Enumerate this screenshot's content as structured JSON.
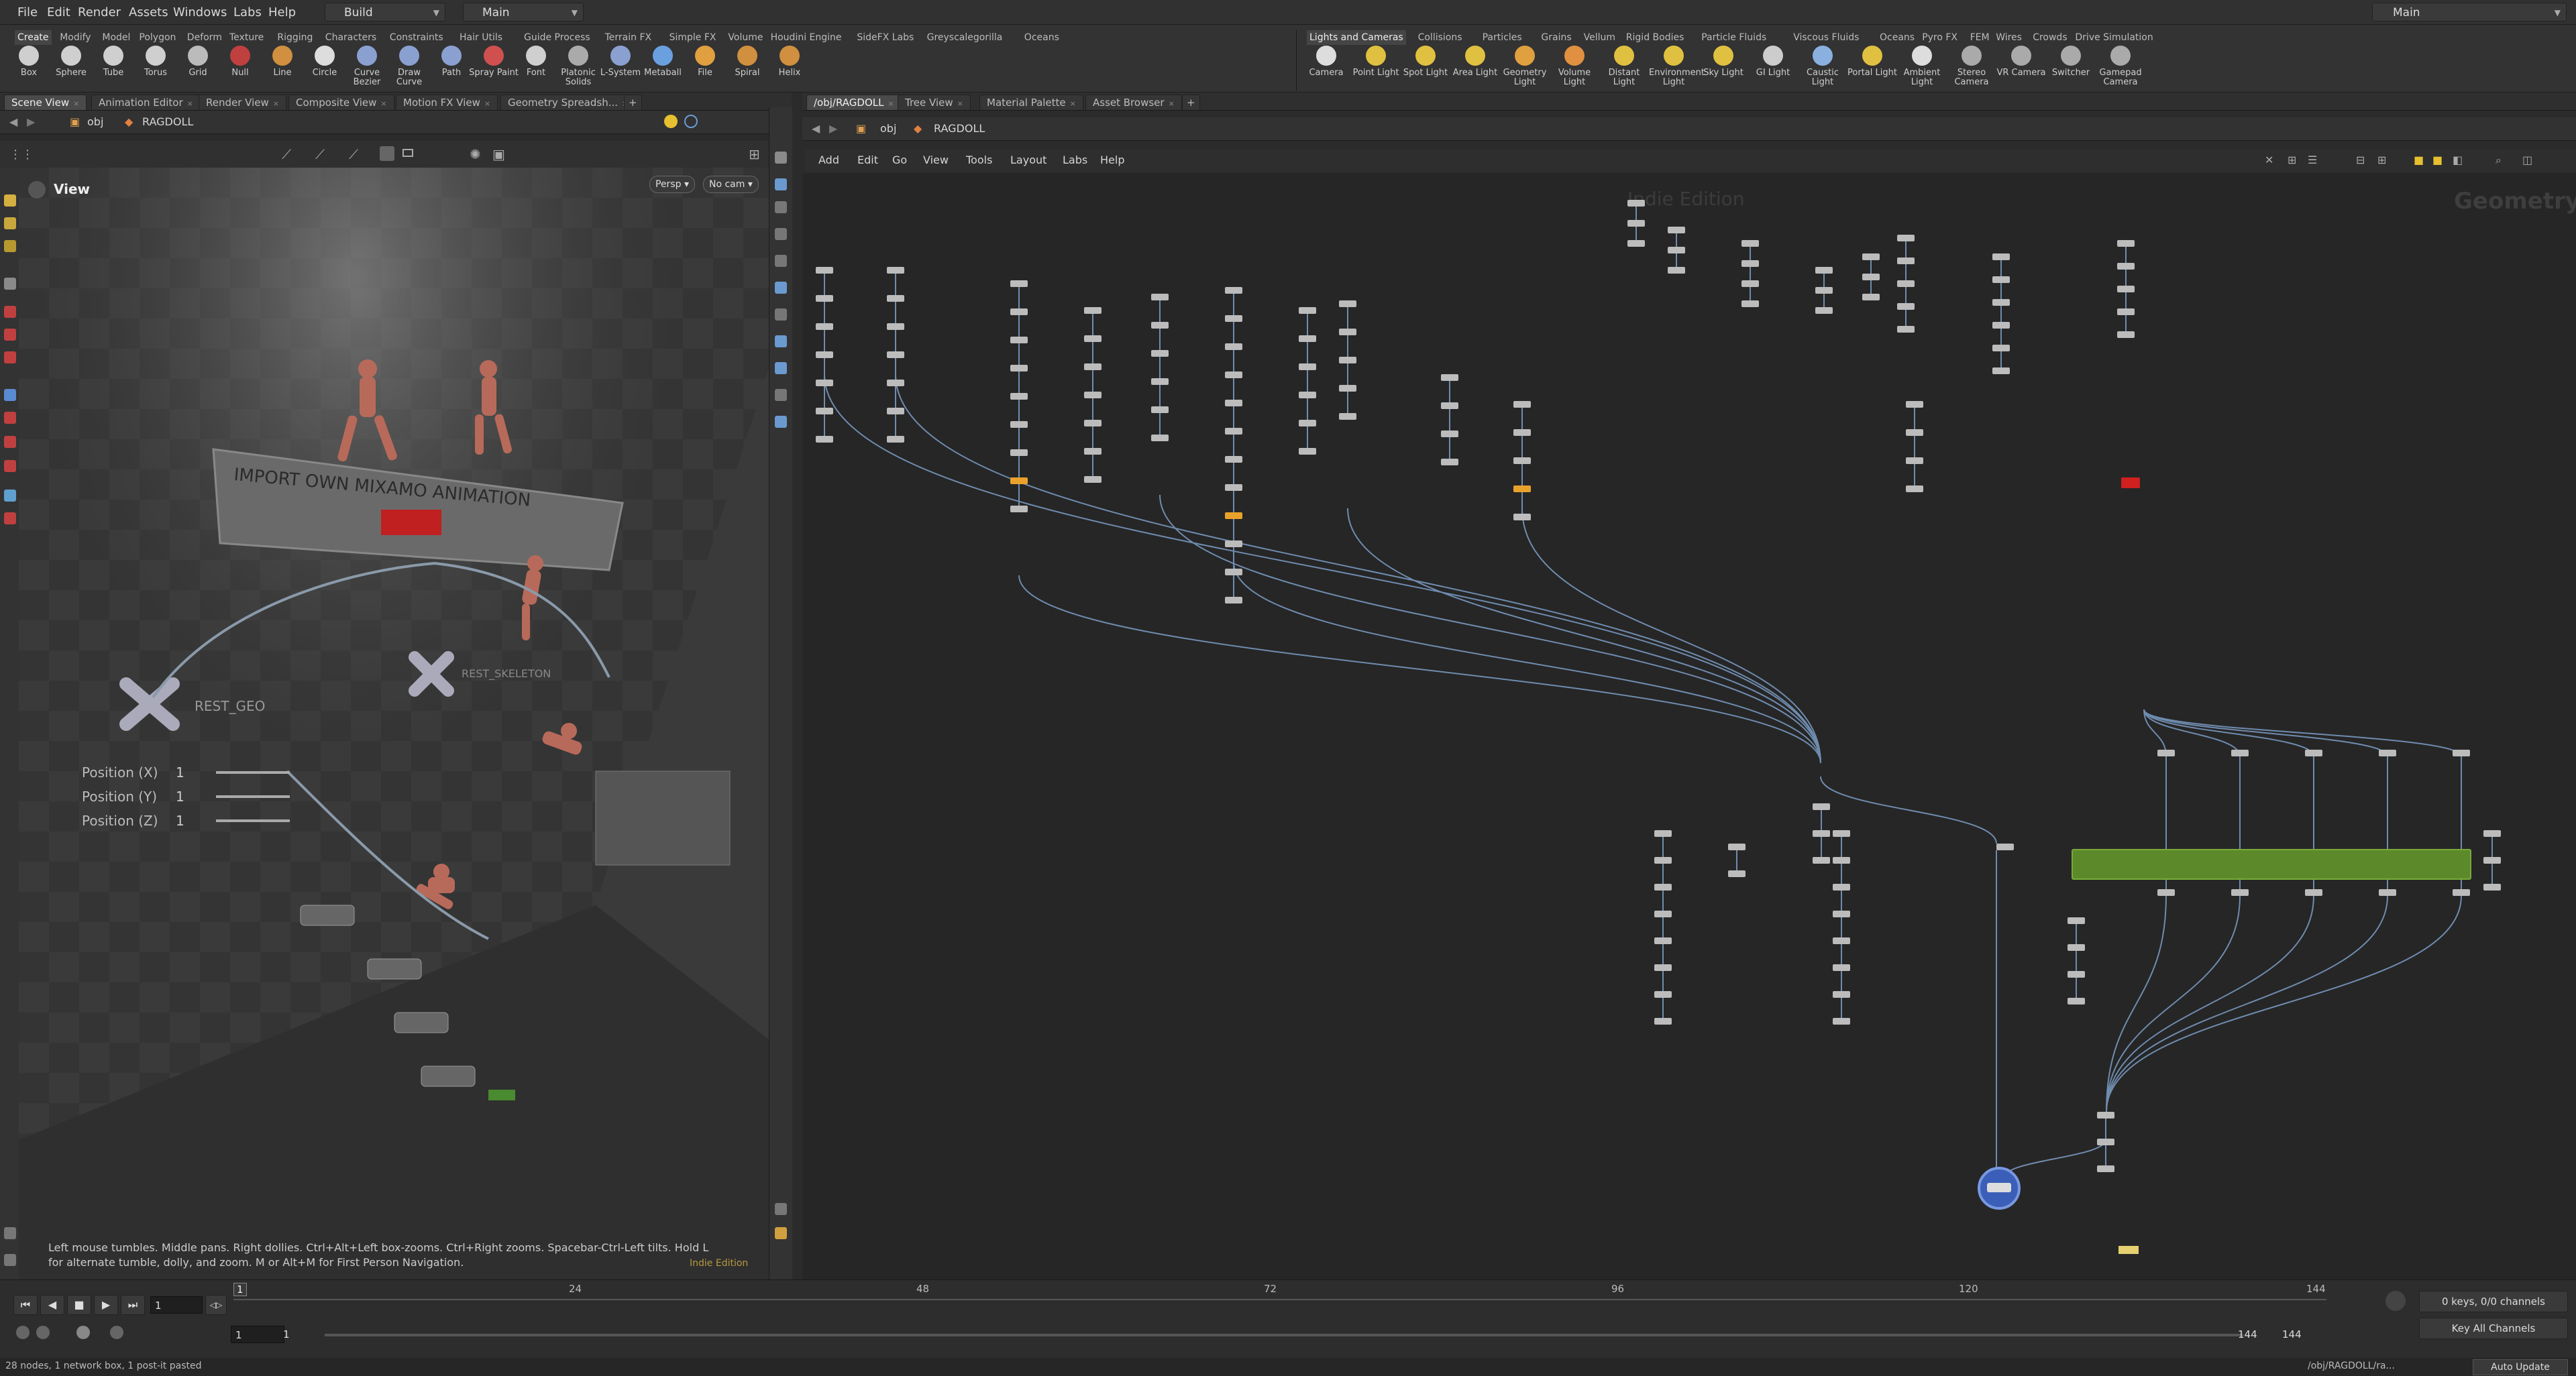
{
  "menubar": {
    "items": [
      "File",
      "Edit",
      "Render",
      "Assets",
      "Windows",
      "Labs",
      "Help"
    ],
    "desktop": "Build",
    "context": "Main",
    "right_context": "Main"
  },
  "shelf_left": {
    "tabs": [
      "Create",
      "Modify",
      "Model",
      "Polygon",
      "Deform",
      "Texture",
      "Rigging",
      "Characters",
      "Constraints",
      "Hair Utils",
      "Guide Process",
      "Terrain FX",
      "Simple FX",
      "Volume",
      "Houdini Engine",
      "SideFX Labs",
      "Greyscalegorilla",
      "Oceans"
    ],
    "tools": [
      "Box",
      "Sphere",
      "Tube",
      "Torus",
      "Grid",
      "Null",
      "Line",
      "Circle",
      "Curve Bezier",
      "Draw Curve",
      "Path",
      "Spray Paint",
      "Font",
      "Platonic Solids",
      "L-System",
      "Metaball",
      "File",
      "Spiral",
      "Helix"
    ]
  },
  "shelf_right": {
    "tabs": [
      "Lights and Cameras",
      "Collisions",
      "Particles",
      "Grains",
      "Vellum",
      "Rigid Bodies",
      "Particle Fluids",
      "Viscous Fluids",
      "Oceans",
      "Pyro FX",
      "FEM",
      "Wires",
      "Crowds",
      "Drive Simulation"
    ],
    "tools": [
      "Camera",
      "Point Light",
      "Spot Light",
      "Area Light",
      "Geometry Light",
      "Volume Light",
      "Distant Light",
      "Environment Light",
      "Sky Light",
      "GI Light",
      "Caustic Light",
      "Portal Light",
      "Ambient Light",
      "Stereo Camera",
      "VR Camera",
      "Switcher",
      "Gamepad Camera"
    ]
  },
  "left_panetabs": [
    "Scene View",
    "Animation Editor",
    "Render View",
    "Composite View",
    "Motion FX View",
    "Geometry Spreadsh..."
  ],
  "left_path": {
    "context": "obj",
    "node": "RAGDOLL"
  },
  "viewport": {
    "title": "View",
    "persp": "Persp",
    "cam": "No cam",
    "sign_text": "IMPORT OWN MIXAMO ANIMATION",
    "rest_geo": "REST_GEO",
    "rest_skeleton": "REST_SKELETON",
    "params": [
      {
        "label": "Position (X)",
        "value": "1"
      },
      {
        "label": "Position (Y)",
        "value": "1"
      },
      {
        "label": "Position (Z)",
        "value": "1"
      }
    ],
    "hint": "Left mouse tumbles. Middle pans. Right dollies. Ctrl+Alt+Left box-zooms. Ctrl+Right zooms. Spacebar-Ctrl-Left tilts. Hold L for alternate tumble, dolly, and zoom. M or Alt+M for First Person Navigation.",
    "edition": "Indie Edition"
  },
  "right_panetabs": [
    "/obj/RAGDOLL",
    "Tree View",
    "Material Palette",
    "Asset Browser"
  ],
  "right_path": {
    "context": "obj",
    "node": "RAGDOLL"
  },
  "network": {
    "menu": [
      "Add",
      "Edit",
      "Go",
      "View",
      "Tools",
      "Layout",
      "Labs",
      "Help"
    ],
    "watermark": "Indie Edition",
    "context_label": "Geometry"
  },
  "timeline": {
    "ticks": [
      "24",
      "48",
      "72",
      "96",
      "120",
      "144"
    ],
    "current_frame": "1",
    "start": "1",
    "start2": "1",
    "end": "144",
    "end2": "144",
    "keys_info": "0 keys, 0/0 channels",
    "key_all": "Key All Channels",
    "auto_update": "Auto Update",
    "status": "28 nodes, 1 network box, 1 post-it pasted",
    "path_status": "/obj/RAGDOLL/ra..."
  },
  "colors": {
    "accent": "#e8a22c",
    "network_box": "#5c8a2a",
    "selected": "#3b5fb8"
  }
}
